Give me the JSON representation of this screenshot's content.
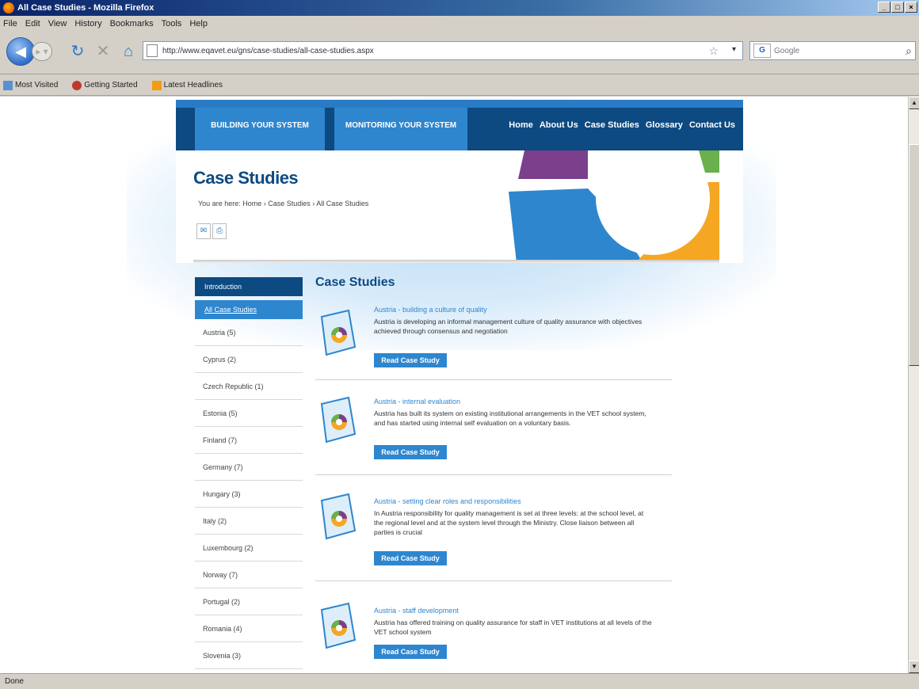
{
  "window": {
    "title": "All Case Studies - Mozilla Firefox"
  },
  "menu": [
    "File",
    "Edit",
    "View",
    "History",
    "Bookmarks",
    "Tools",
    "Help"
  ],
  "address": {
    "url": "http://www.eqavet.eu/gns/case-studies/all-case-studies.aspx"
  },
  "search": {
    "placeholder": "Google"
  },
  "bookmarks": [
    "Most Visited",
    "Getting Started",
    "Latest Headlines"
  ],
  "status": "Done",
  "site": {
    "tabs": [
      "BUILDING YOUR SYSTEM",
      "MONITORING YOUR SYSTEM"
    ],
    "nav": [
      "Home",
      "About Us",
      "Case Studies",
      "Glossary",
      "Contact Us"
    ],
    "page_title": "Case Studies",
    "breadcrumb": "You are here: Home › Case Studies › All Case Studies",
    "sidebar": {
      "intro": "Introduction",
      "all": "All Case Studies",
      "items": [
        "Austria (5)",
        "Cyprus (2)",
        "Czech Republic (1)",
        "Estonia (5)",
        "Finland (7)",
        "Germany (7)",
        "Hungary (3)",
        "Italy (2)",
        "Luxembourg (2)",
        "Norway (7)",
        "Portugal (2)",
        "Romania (4)",
        "Slovenia (3)"
      ]
    },
    "main_title": "Case Studies",
    "cases": [
      {
        "title": "Austria - building a culture of quality",
        "desc": "Austria is developing an informal management culture of quality assurance with objectives achieved through consensus and negotiation",
        "button": "Read Case Study"
      },
      {
        "title": "Austria - internal evaluation",
        "desc": "Austria has built its system on existing institutional arrangements in the VET school system, and has started using internal self evaluation on a voluntary basis.",
        "button": "Read Case Study"
      },
      {
        "title": "Austria - setting clear roles and responsibilities",
        "desc": "In Austria responsibility for quality management is set at three levels: at the school level, at the regional level and at the system level through the Ministry. Close liaison between all parties is crucial",
        "button": "Read Case Study"
      },
      {
        "title": "Austria - staff development",
        "desc": "Austria has offered training on quality assurance for staff in VET institutions at all levels of the VET school system",
        "button": "Read Case Study"
      }
    ]
  },
  "colors": {
    "navy": "#0d4a82",
    "blue": "#2e86cf",
    "purple": "#7b3f8c",
    "green": "#6ab04c",
    "orange": "#f5a623"
  }
}
